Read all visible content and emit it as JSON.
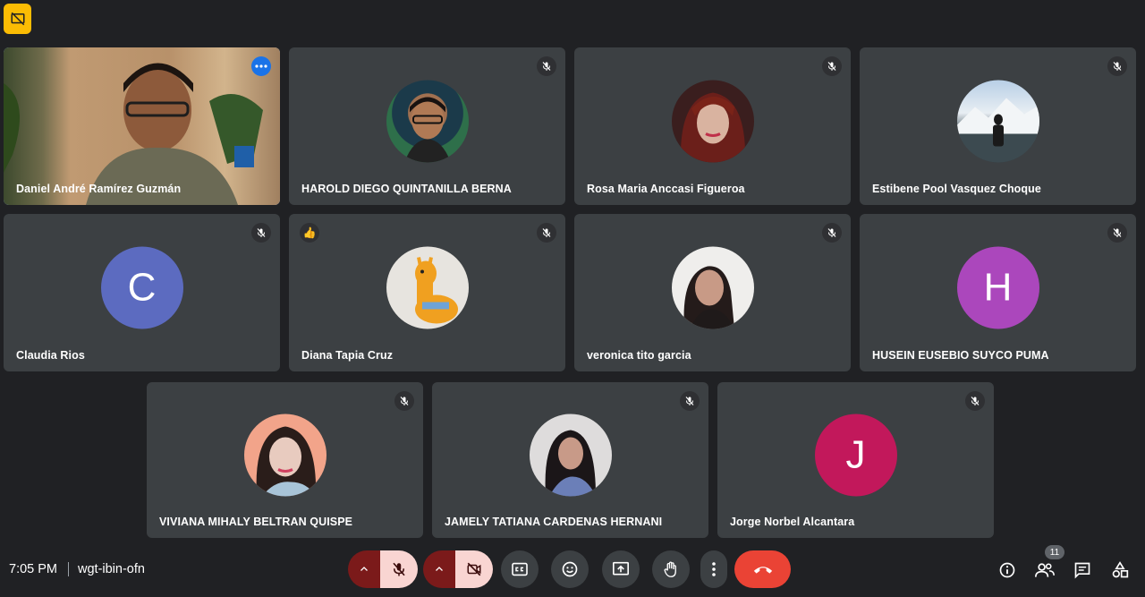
{
  "meeting": {
    "time": "7:05 PM",
    "code": "wgt-ibin-ofn",
    "participant_count": "11"
  },
  "colors": {
    "background": "#202124",
    "tile": "#3c4043",
    "active_outline": "#8ab4f8",
    "hangup": "#ea4335",
    "muted_control": "#f9d5d2",
    "warning_badge": "#fbbc04"
  },
  "participants": [
    {
      "name": "Daniel André Ramírez Guzmán",
      "avatar": "video-feed",
      "muted": false
    },
    {
      "name": "HAROLD DIEGO QUINTANILLA BERNA",
      "avatar": "photo",
      "muted": true
    },
    {
      "name": "Rosa Maria Anccasi Figueroa",
      "avatar": "photo",
      "muted": true
    },
    {
      "name": "Estibene Pool Vasquez Choque",
      "avatar": "photo",
      "muted": true
    },
    {
      "name": "Claudia Rios",
      "avatar": "letter",
      "letter": "C",
      "avatar_color": "#5c6bc0",
      "muted": true
    },
    {
      "name": "Diana Tapia Cruz",
      "avatar": "photo",
      "muted": true,
      "reaction": "thumbs-up"
    },
    {
      "name": "veronica tito garcia",
      "avatar": "photo",
      "muted": true
    },
    {
      "name": "HUSEIN EUSEBIO SUYCO PUMA",
      "avatar": "letter",
      "letter": "H",
      "avatar_color": "#ab47bc",
      "muted": true
    },
    {
      "name": "VIVIANA MIHALY BELTRAN QUISPE",
      "avatar": "photo",
      "muted": true
    },
    {
      "name": "JAMELY TATIANA CARDENAS HERNANI",
      "avatar": "photo",
      "muted": true
    },
    {
      "name": "Jorge Norbel Alcantara",
      "avatar": "letter",
      "letter": "J",
      "avatar_color": "#c2185b",
      "muted": true
    }
  ]
}
